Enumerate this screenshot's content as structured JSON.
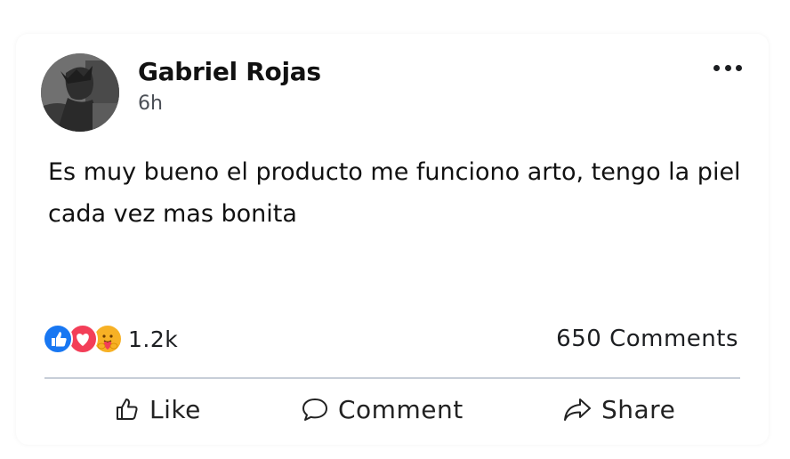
{
  "post": {
    "author": "Gabriel Rojas",
    "time": "6h",
    "text": "Es muy bueno el producto me funciono arto, tengo la piel cada vez mas bonita"
  },
  "reactions": {
    "icons": [
      "like-icon",
      "love-icon",
      "care-icon"
    ],
    "count": "1.2k"
  },
  "comments": {
    "count_label": "650 Comments"
  },
  "actions": {
    "like": "Like",
    "comment": "Comment",
    "share": "Share"
  },
  "colors": {
    "like_blue": "#1877f2",
    "love_red": "#f33e58",
    "care_yellow": "#f7b125",
    "divider": "#c7ced8"
  }
}
